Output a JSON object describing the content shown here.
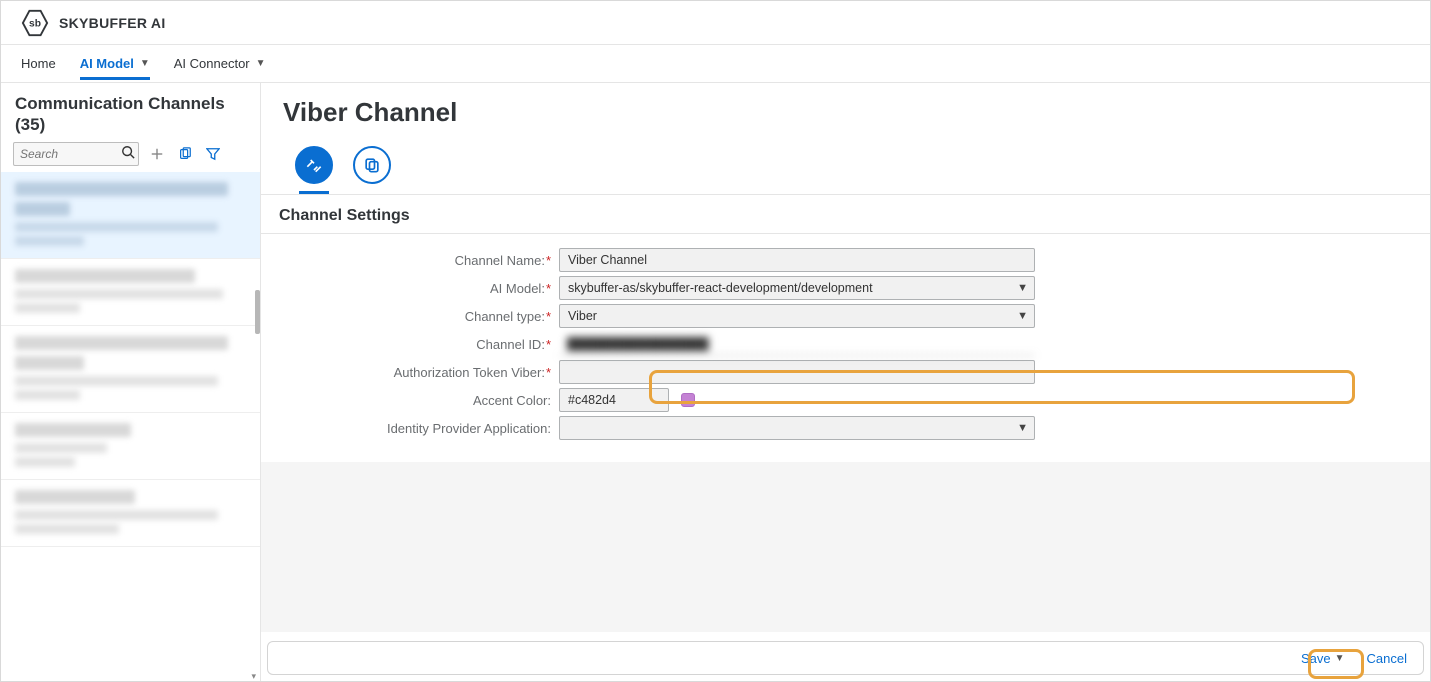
{
  "brand": "SKYBUFFER AI",
  "logo_text": "sb",
  "nav": {
    "home": "Home",
    "ai_model": "AI Model",
    "ai_connector": "AI Connector"
  },
  "sidebar": {
    "title": "Communication Channels (35)",
    "search_placeholder": "Search"
  },
  "page": {
    "title": "Viber Channel",
    "section": "Channel Settings"
  },
  "form": {
    "channel_name": {
      "label": "Channel Name:",
      "value": "Viber Channel"
    },
    "ai_model": {
      "label": "AI Model:",
      "value": "skybuffer-as/skybuffer-react-development/development"
    },
    "channel_type": {
      "label": "Channel type:",
      "value": "Viber"
    },
    "channel_id": {
      "label": "Channel ID:",
      "value": ""
    },
    "auth_token": {
      "label": "Authorization Token Viber:",
      "value": ""
    },
    "accent_color": {
      "label": "Accent Color:",
      "value": "#c482d4"
    },
    "idp_app": {
      "label": "Identity Provider Application:",
      "value": ""
    }
  },
  "footer": {
    "save": "Save",
    "cancel": "Cancel"
  }
}
